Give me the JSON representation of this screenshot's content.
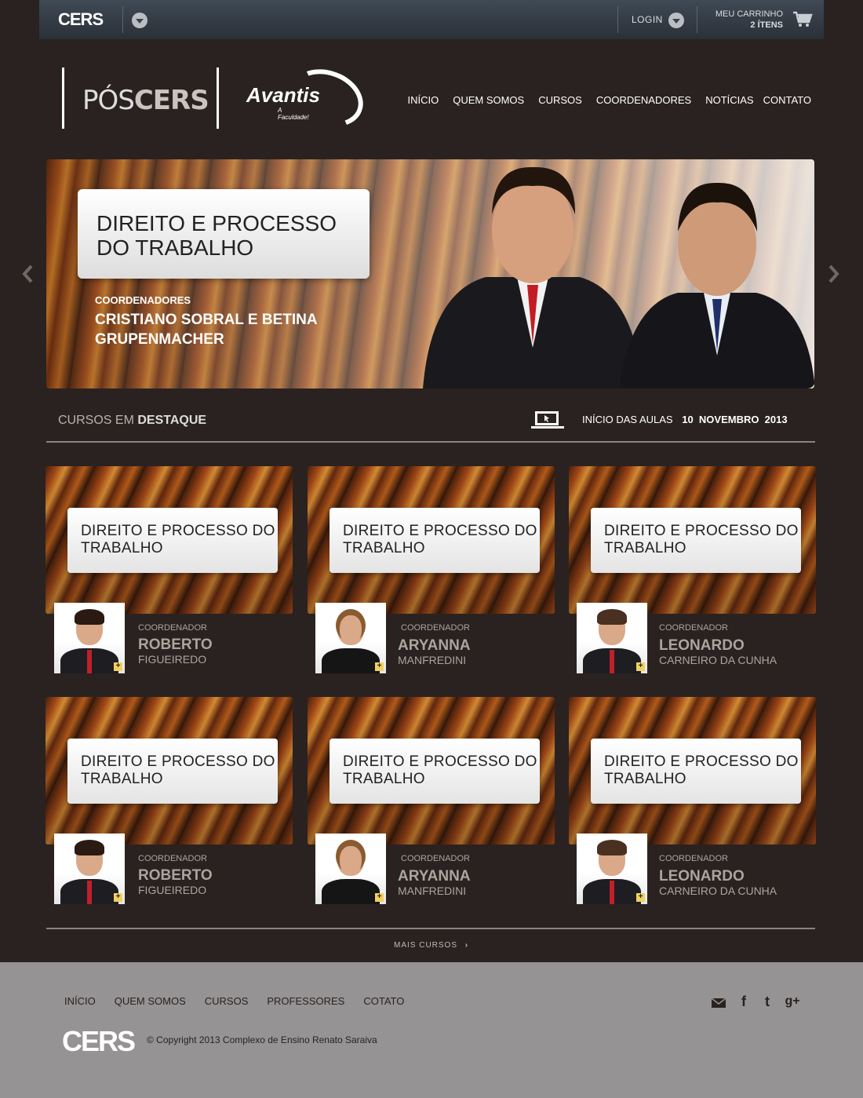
{
  "topbar": {
    "logo": "CERS",
    "login": "LOGIN",
    "cart_label": "MEU CARRINHO",
    "cart_count": "2 ÍTENS"
  },
  "brand": {
    "pos": "PÓS",
    "cers": "CERS",
    "avantis": "Avantis",
    "avantis_sub": "A Faculdade!"
  },
  "nav": [
    "INÍCIO",
    "QUEM SOMOS",
    "CURSOS",
    "COORDENADORES",
    "NOTÍCIAS",
    "CONTATO"
  ],
  "hero": {
    "title": "DIREITO E PROCESSO DO TRABALHO",
    "coord_label": "COORDENADORES",
    "coord_names": "CRISTIANO SOBRAL E BETINA GRUPENMACHER"
  },
  "section": {
    "label": "CURSOS EM",
    "label_bold": "DESTAQUE",
    "inicio": "INÍCIO DAS AULAS",
    "date": "10  NOVEMBRO  2013"
  },
  "courses": [
    {
      "title": "DIREITO E PROCESSO DO TRABALHO",
      "coord": "COORDENADOR",
      "first": "ROBERTO",
      "last": "FIGUEIREDO"
    },
    {
      "title": "DIREITO E PROCESSO DO TRABALHO",
      "coord": "COORDENADOR",
      "first": "ARYANNA",
      "last": "MANFREDINI"
    },
    {
      "title": "DIREITO E PROCESSO DO TRABALHO",
      "coord": "COORDENADOR",
      "first": "LEONARDO",
      "last": "CARNEIRO DA CUNHA"
    },
    {
      "title": "DIREITO E PROCESSO DO TRABALHO",
      "coord": "COORDENADOR",
      "first": "ROBERTO",
      "last": "FIGUEIREDO"
    },
    {
      "title": "DIREITO E PROCESSO DO TRABALHO",
      "coord": "COORDENADOR",
      "first": "ARYANNA",
      "last": "MANFREDINI"
    },
    {
      "title": "DIREITO E PROCESSO DO TRABALHO",
      "coord": "COORDENADOR",
      "first": "LEONARDO",
      "last": "CARNEIRO DA CUNHA"
    }
  ],
  "more": "MAIS CURSOS",
  "footer": {
    "nav": [
      "INÍCIO",
      "QUEM SOMOS",
      "CURSOS",
      "PROFESSORES",
      "COTATO"
    ],
    "logo": "CERS",
    "copyright": "© Copyright 2013 Complexo de Ensino Renato Saraiva"
  },
  "colors": {
    "background": "#2a2220",
    "footer": "#959393",
    "topbar": "#3a434c"
  }
}
